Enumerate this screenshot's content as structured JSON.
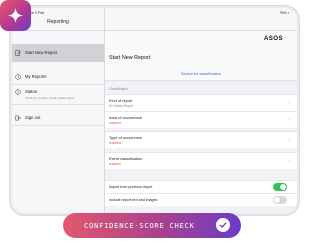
{
  "statusbar": {
    "time": "Tue 2 Feb",
    "battery": "76% ▪"
  },
  "sidebar": {
    "title": "Reporting",
    "items": [
      {
        "label": "Start New Report",
        "icon": "edit-icon",
        "active": true
      },
      {
        "label": "My Reports",
        "icon": "clock-icon"
      },
      {
        "label": "Status",
        "sub": "Check for updates, check upload status",
        "icon": "info-icon"
      },
      {
        "label": "Sign out",
        "icon": "signout-icon"
      }
    ]
  },
  "main": {
    "logo": "ASOS",
    "title": "Start New Report",
    "search_link": "Search for classification",
    "section_label": "Classification",
    "fields": [
      {
        "label": "Kind of report",
        "value": "Air Safety Report",
        "required": false
      },
      {
        "label": "Area of occurrence",
        "value": "required",
        "required": true
      },
      {
        "label": "Type of occurrence",
        "value": "required",
        "required": true
      },
      {
        "label": "Event classification",
        "value": "required",
        "required": true
      }
    ],
    "toggles": [
      {
        "label": "Import from previous report",
        "on": true
      },
      {
        "label": "Include report text and images",
        "on": false
      }
    ]
  },
  "pill": {
    "label": "CONFIDENCE-SCORE CHECK",
    "icon": "checkmark-icon"
  },
  "badge": {
    "icon": "sparkle-icon"
  },
  "colors": {
    "accent": "#2f6ae0",
    "required": "#e0503a",
    "toggle_on": "#36c25b",
    "pill_start": "#e4596d",
    "pill_end": "#6a3bc6"
  }
}
